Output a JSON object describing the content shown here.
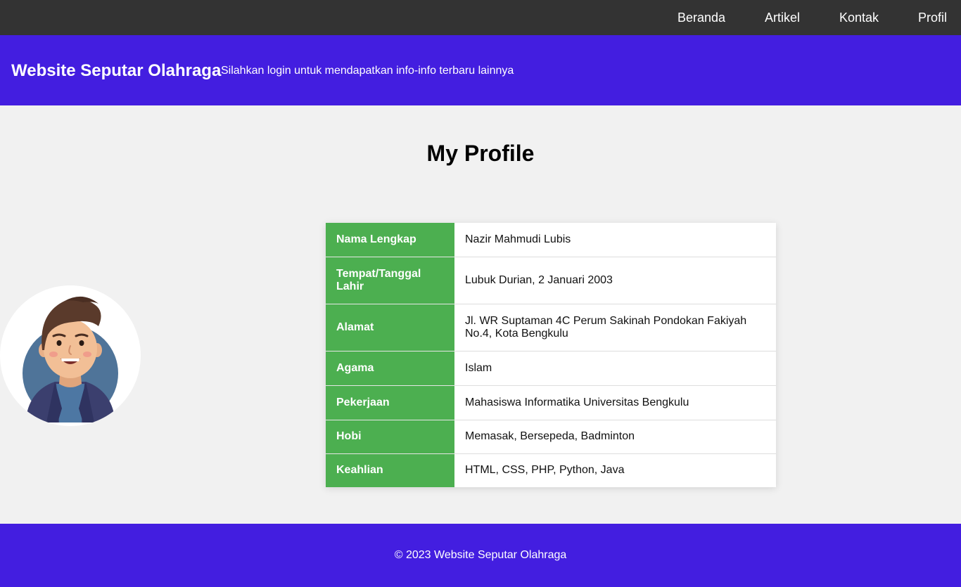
{
  "nav": {
    "items": [
      "Beranda",
      "Artikel",
      "Kontak",
      "Profil"
    ]
  },
  "header": {
    "title": "Website Seputar Olahraga",
    "tagline": "Silahkan login untuk mendapatkan info-info terbaru lainnya"
  },
  "main": {
    "title": "My Profile",
    "avatar_icon": "person-avatar-icon",
    "profile": [
      {
        "label": "Nama Lengkap",
        "value": "Nazir Mahmudi Lubis"
      },
      {
        "label": "Tempat/Tanggal Lahir",
        "value": "Lubuk Durian, 2 Januari 2003"
      },
      {
        "label": "Alamat",
        "value": "Jl. WR Suptaman 4C Perum Sakinah Pondokan Fakiyah No.4, Kota Bengkulu"
      },
      {
        "label": "Agama",
        "value": "Islam"
      },
      {
        "label": "Pekerjaan",
        "value": "Mahasiswa Informatika Universitas Bengkulu"
      },
      {
        "label": "Hobi",
        "value": "Memasak, Bersepeda, Badminton"
      },
      {
        "label": "Keahlian",
        "value": "HTML, CSS, PHP, Python, Java"
      }
    ]
  },
  "footer": {
    "copyright": "© 2023 Website Seputar Olahraga"
  },
  "colors": {
    "nav_bg": "#333333",
    "brand": "#431ee0",
    "label_bg": "#4caf50",
    "page_bg": "#f1f1f1"
  }
}
